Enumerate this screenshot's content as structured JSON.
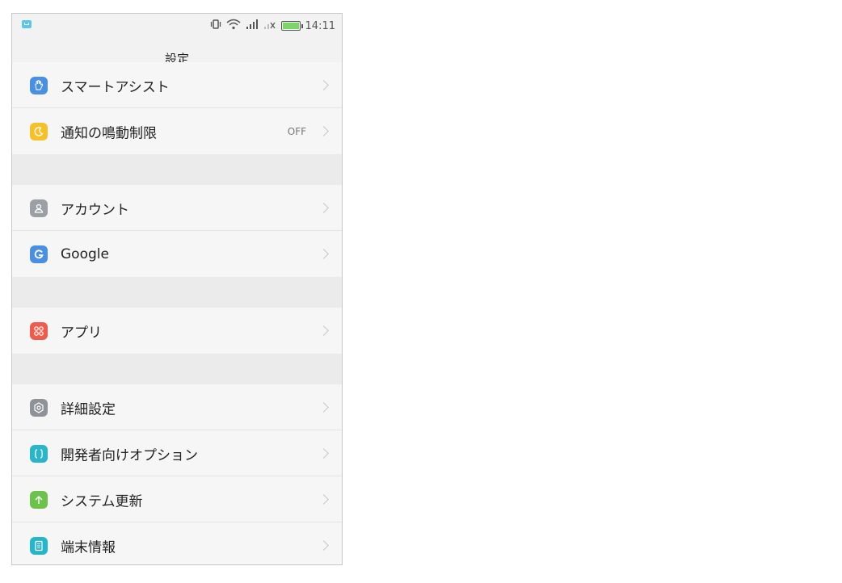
{
  "status_bar": {
    "time": "14:11",
    "icons": [
      "vibrate-icon",
      "wifi-icon",
      "signal-icon",
      "no-signal-icon",
      "battery-charging-icon"
    ]
  },
  "header": {
    "title": "設定"
  },
  "settings": {
    "smart_assist": {
      "label": "スマートアシスト",
      "icon": "hand-icon",
      "color": "#4a90e2"
    },
    "do_not_disturb": {
      "label": "通知の鳴動制限",
      "value": "OFF",
      "icon": "moon-icon",
      "color": "#f5c02a"
    },
    "account": {
      "label": "アカウント",
      "icon": "user-icon",
      "color": "#9aa0a6"
    },
    "google": {
      "label": "Google",
      "icon": "google-icon",
      "color": "#4a90e2"
    },
    "apps": {
      "label": "アプリ",
      "icon": "apps-grid-icon",
      "color": "#ef5b4c"
    },
    "advanced": {
      "label": "詳細設定",
      "icon": "gear-icon",
      "color": "#8e9399"
    },
    "developer": {
      "label": "開発者向けオプション",
      "icon": "braces-icon",
      "color": "#2bb5c9"
    },
    "system_update": {
      "label": "システム更新",
      "icon": "arrow-up-icon",
      "color": "#6cc24a"
    },
    "device_info": {
      "label": "端末情報",
      "icon": "phone-info-icon",
      "color": "#26b6c9"
    }
  }
}
